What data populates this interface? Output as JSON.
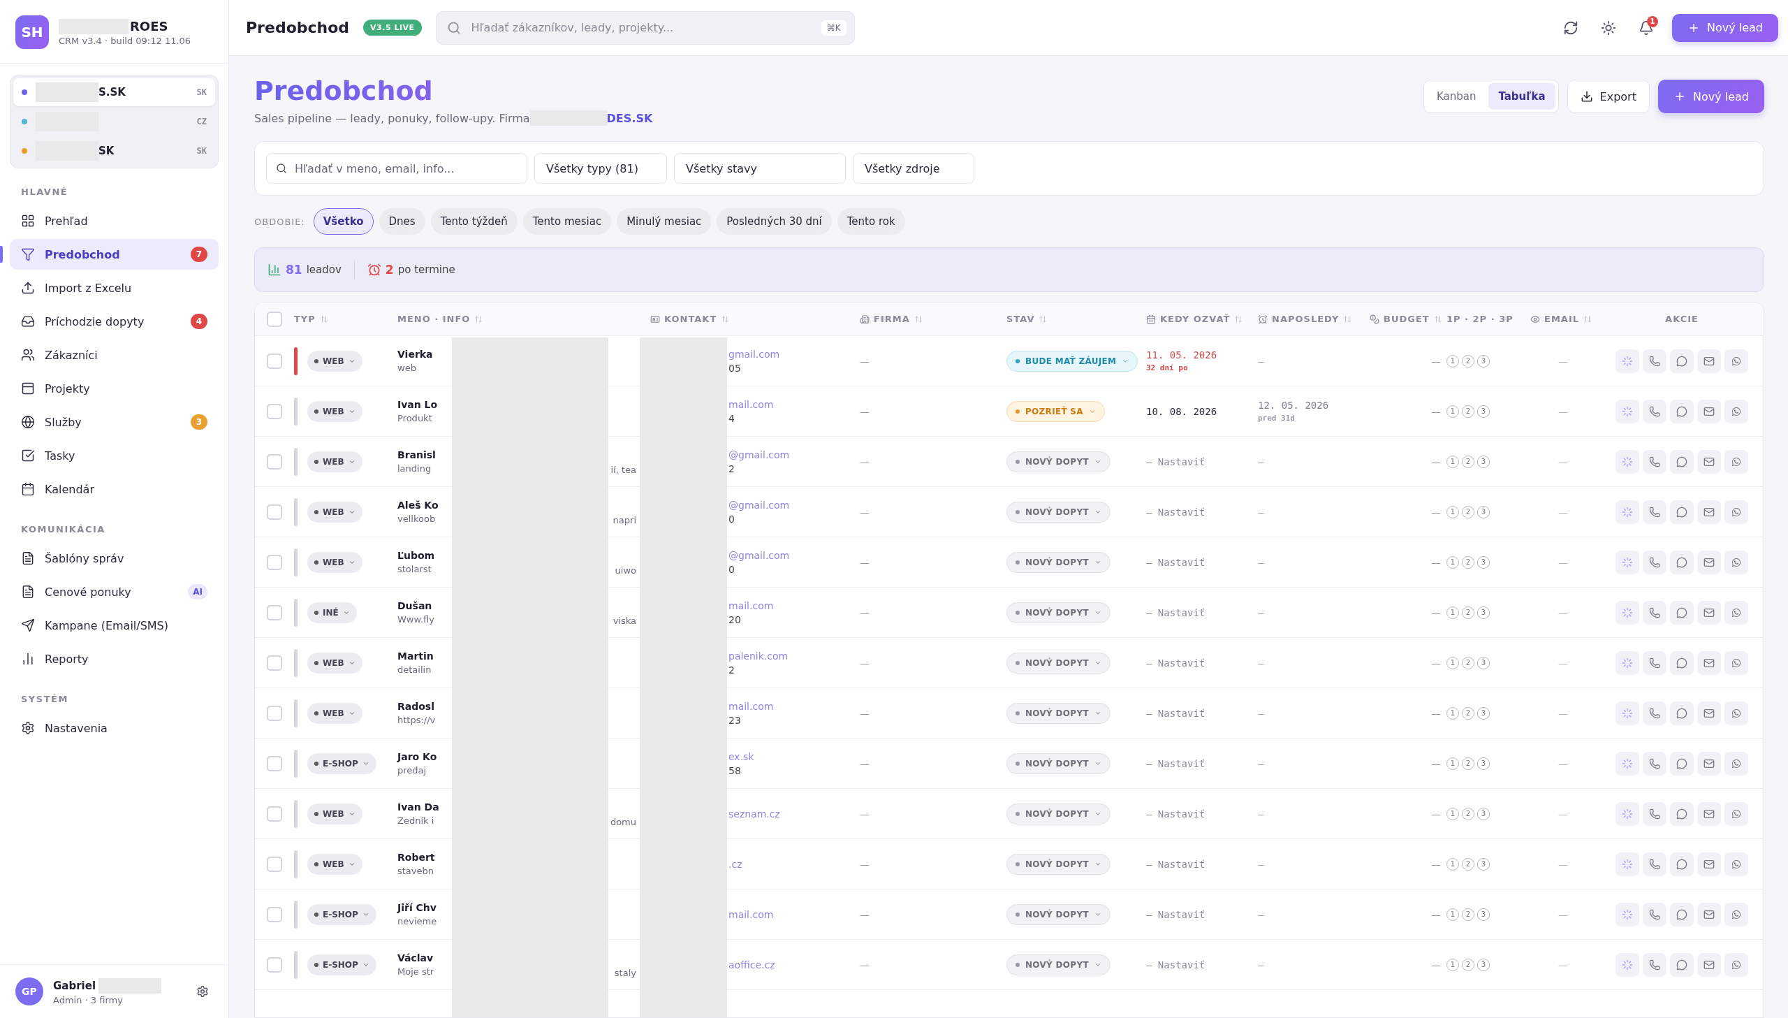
{
  "brand": {
    "logo": "SH",
    "name": "ROES",
    "version": "CRM v3.4 · build 09:12 11.06"
  },
  "companies": [
    {
      "name": "S.SK",
      "code": "SK",
      "color": "#6b63e8",
      "selected": true
    },
    {
      "code": "CZ",
      "color": "#4fb6d0",
      "selected": false
    },
    {
      "name": "SK",
      "code": "SK",
      "color": "#e8a030",
      "selected": false
    }
  ],
  "nav_sections": [
    {
      "title": "HLAVNÉ",
      "items": [
        {
          "label": "Prehľad",
          "selected": false
        },
        {
          "label": "Predobchod",
          "selected": true,
          "badge": "7",
          "color": "#e04848"
        },
        {
          "label": "Import z Excelu",
          "selected": false
        },
        {
          "label": "Príchodzie dopyty",
          "selected": false,
          "badge": "4",
          "color": "#e04848"
        },
        {
          "label": "Zákazníci",
          "selected": false
        },
        {
          "label": "Projekty",
          "selected": false
        },
        {
          "label": "Služby",
          "selected": false,
          "badge": "3",
          "color": "#e8a030"
        },
        {
          "label": "Tasky",
          "selected": false
        },
        {
          "label": "Kalendár",
          "selected": false
        }
      ]
    },
    {
      "title": "KOMUNIKÁCIA",
      "items": [
        {
          "label": "Šablóny správ",
          "selected": false
        },
        {
          "label": "Cenové ponuky",
          "selected": false,
          "badge": "AI",
          "color": "#ebe8fb"
        },
        {
          "label": "Kampane (Email/SMS)",
          "selected": false
        },
        {
          "label": "Reporty",
          "selected": false
        }
      ]
    },
    {
      "title": "SYSTÉM",
      "items": [
        {
          "label": "Nastavenia",
          "selected": false
        }
      ]
    }
  ],
  "user": {
    "initials": "GP",
    "name": "Gabriel",
    "role": "Admin · 3 firmy"
  },
  "topbar": {
    "title": "Predobchod",
    "version_badge": "V3.5 LIVE",
    "search_placeholder": "Hľadať zákazníkov, leady, projekty...",
    "shortcut": "⌘K",
    "notifications": "1",
    "new_button": "Nový lead"
  },
  "page": {
    "title": "Predobchod",
    "subtitle_prefix": "Sales pipeline — leady, ponuky, follow-upy. Firma",
    "subtitle_company": "DES.SK",
    "views": [
      {
        "label": "Kanban",
        "selected": false
      },
      {
        "label": "Tabuľka",
        "selected": true
      }
    ],
    "export": "Export",
    "new_button": "Nový lead"
  },
  "filters": {
    "search_placeholder": "Hľadať v meno, email, info...",
    "selects": [
      "Všetky typy (81)",
      "Všetky stavy",
      "Všetky zdroje"
    ]
  },
  "period": {
    "label": "OBDOBIE:",
    "chips": [
      {
        "label": "Všetko",
        "selected": true
      },
      {
        "label": "Dnes",
        "selected": false
      },
      {
        "label": "Tento týždeň",
        "selected": false
      },
      {
        "label": "Tento mesiac",
        "selected": false
      },
      {
        "label": "Minulý mesiac",
        "selected": false
      },
      {
        "label": "Posledných 30 dní",
        "selected": false
      },
      {
        "label": "Tento rok",
        "selected": false
      }
    ]
  },
  "stats": {
    "leads_count": "81",
    "leads_label": "leadov",
    "overdue_count": "2",
    "overdue_label": "po termine"
  },
  "table": {
    "select_all": {
      "checked": false
    },
    "columns": [
      "TYP",
      "MENO · INFO",
      "KONTAKT",
      "FIRMA",
      "STAV",
      "KEDY OZVAŤ",
      "NAPOSLEDY",
      "BUDGET",
      "1P · 2P · 3P",
      "EMAIL",
      "AKCIE"
    ],
    "rows": [
      {
        "checked": false,
        "overdue": true,
        "type": "WEB",
        "name": "Vierka",
        "info": "web",
        "contact": "gmail.com",
        "phone": "05",
        "firma": "—",
        "status": {
          "label": "BUDE MAŤ ZÁUJEM",
          "kind": "interest"
        },
        "next": "11. 05. 2026",
        "next_note": "32 dní po",
        "unset": false,
        "last": "—",
        "budget": "—",
        "steps": [
          "1",
          "2",
          "3"
        ],
        "email": "—"
      },
      {
        "checked": false,
        "overdue": false,
        "type": "WEB",
        "name": "Ivan Lo",
        "info": "Produkt",
        "contact": "mail.com",
        "phone": "4",
        "firma": "—",
        "status": {
          "label": "POZRIEŤ SA",
          "kind": "review"
        },
        "next": "10. 08. 2026",
        "unset": false,
        "last": "12. 05. 2026",
        "last_note": "pred 31d",
        "budget": "—",
        "steps": [
          "1",
          "2",
          "3"
        ],
        "email": "—"
      },
      {
        "checked": false,
        "overdue": false,
        "type": "WEB",
        "name": "Branisl",
        "info": "landing",
        "info_tail": "ií, tea",
        "contact": "@gmail.com",
        "phone": "2",
        "firma": "—",
        "status": {
          "label": "NOVÝ DOPYT",
          "kind": "new"
        },
        "next": "— Nastaviť",
        "unset": true,
        "last": "—",
        "budget": "—",
        "steps": [
          "1",
          "2",
          "3"
        ],
        "email": "—"
      },
      {
        "checked": false,
        "overdue": false,
        "type": "WEB",
        "name": "Aleš Ko",
        "info": "vellkoob",
        "info_tail": "napri",
        "contact": "@gmail.com",
        "phone": "0",
        "firma": "—",
        "status": {
          "label": "NOVÝ DOPYT",
          "kind": "new"
        },
        "next": "— Nastaviť",
        "unset": true,
        "last": "—",
        "budget": "—",
        "steps": [
          "1",
          "2",
          "3"
        ],
        "email": "—"
      },
      {
        "checked": false,
        "overdue": false,
        "type": "WEB",
        "name": "Ľubom",
        "info": "stolarst",
        "info_tail": "uiwo",
        "contact": "@gmail.com",
        "phone": "0",
        "firma": "—",
        "status": {
          "label": "NOVÝ DOPYT",
          "kind": "new"
        },
        "next": "— Nastaviť",
        "unset": true,
        "last": "—",
        "budget": "—",
        "steps": [
          "1",
          "2",
          "3"
        ],
        "email": "—"
      },
      {
        "checked": false,
        "overdue": false,
        "type": "INÉ",
        "name": "Dušan",
        "info": "Www.fly",
        "info_tail": "viska",
        "contact": "mail.com",
        "phone": "20",
        "firma": "—",
        "status": {
          "label": "NOVÝ DOPYT",
          "kind": "new"
        },
        "next": "— Nastaviť",
        "unset": true,
        "last": "—",
        "budget": "—",
        "steps": [
          "1",
          "2",
          "3"
        ],
        "email": "—"
      },
      {
        "checked": false,
        "overdue": false,
        "type": "WEB",
        "name": "Martin",
        "info": "detailin",
        "contact": "palenik.com",
        "phone": "2",
        "firma": "—",
        "status": {
          "label": "NOVÝ DOPYT",
          "kind": "new"
        },
        "next": "— Nastaviť",
        "unset": true,
        "last": "—",
        "budget": "—",
        "steps": [
          "1",
          "2",
          "3"
        ],
        "email": "—"
      },
      {
        "checked": false,
        "overdue": false,
        "type": "WEB",
        "name": "Radosl",
        "info": "https://v",
        "contact": "mail.com",
        "phone": "23",
        "firma": "—",
        "status": {
          "label": "NOVÝ DOPYT",
          "kind": "new"
        },
        "next": "— Nastaviť",
        "unset": true,
        "last": "—",
        "budget": "—",
        "steps": [
          "1",
          "2",
          "3"
        ],
        "email": "—"
      },
      {
        "checked": false,
        "overdue": false,
        "type": "E-SHOP",
        "name": "Jaro Ko",
        "info": "predaj",
        "contact": "ex.sk",
        "phone": "58",
        "firma": "—",
        "status": {
          "label": "NOVÝ DOPYT",
          "kind": "new"
        },
        "next": "— Nastaviť",
        "unset": true,
        "last": "—",
        "budget": "—",
        "steps": [
          "1",
          "2",
          "3"
        ],
        "email": "—"
      },
      {
        "checked": false,
        "overdue": false,
        "type": "WEB",
        "name": "Ivan Da",
        "info": "Zedník i",
        "info_tail": "domu",
        "contact": "seznam.cz",
        "firma": "—",
        "status": {
          "label": "NOVÝ DOPYT",
          "kind": "new"
        },
        "next": "— Nastaviť",
        "unset": true,
        "last": "—",
        "budget": "—",
        "steps": [
          "1",
          "2",
          "3"
        ],
        "email": "—"
      },
      {
        "checked": false,
        "overdue": false,
        "type": "WEB",
        "name": "Robert",
        "info": "stavebn",
        "contact": ".cz",
        "firma": "—",
        "status": {
          "label": "NOVÝ DOPYT",
          "kind": "new"
        },
        "next": "— Nastaviť",
        "unset": true,
        "last": "—",
        "budget": "—",
        "steps": [
          "1",
          "2",
          "3"
        ],
        "email": "—"
      },
      {
        "checked": false,
        "overdue": false,
        "type": "E-SHOP",
        "name": "Jiří Chv",
        "info": "nevieme",
        "contact": "mail.com",
        "firma": "—",
        "status": {
          "label": "NOVÝ DOPYT",
          "kind": "new"
        },
        "next": "— Nastaviť",
        "unset": true,
        "last": "—",
        "budget": "—",
        "steps": [
          "1",
          "2",
          "3"
        ],
        "email": "—"
      },
      {
        "checked": false,
        "overdue": false,
        "type": "E-SHOP",
        "name": "Václav",
        "info": "Moje str",
        "info_tail": "staly",
        "contact": "aoffice.cz",
        "firma": "—",
        "status": {
          "label": "NOVÝ DOPYT",
          "kind": "new"
        },
        "next": "— Nastaviť",
        "unset": true,
        "last": "—",
        "budget": "—",
        "steps": [
          "1",
          "2",
          "3"
        ],
        "email": "—"
      }
    ]
  }
}
